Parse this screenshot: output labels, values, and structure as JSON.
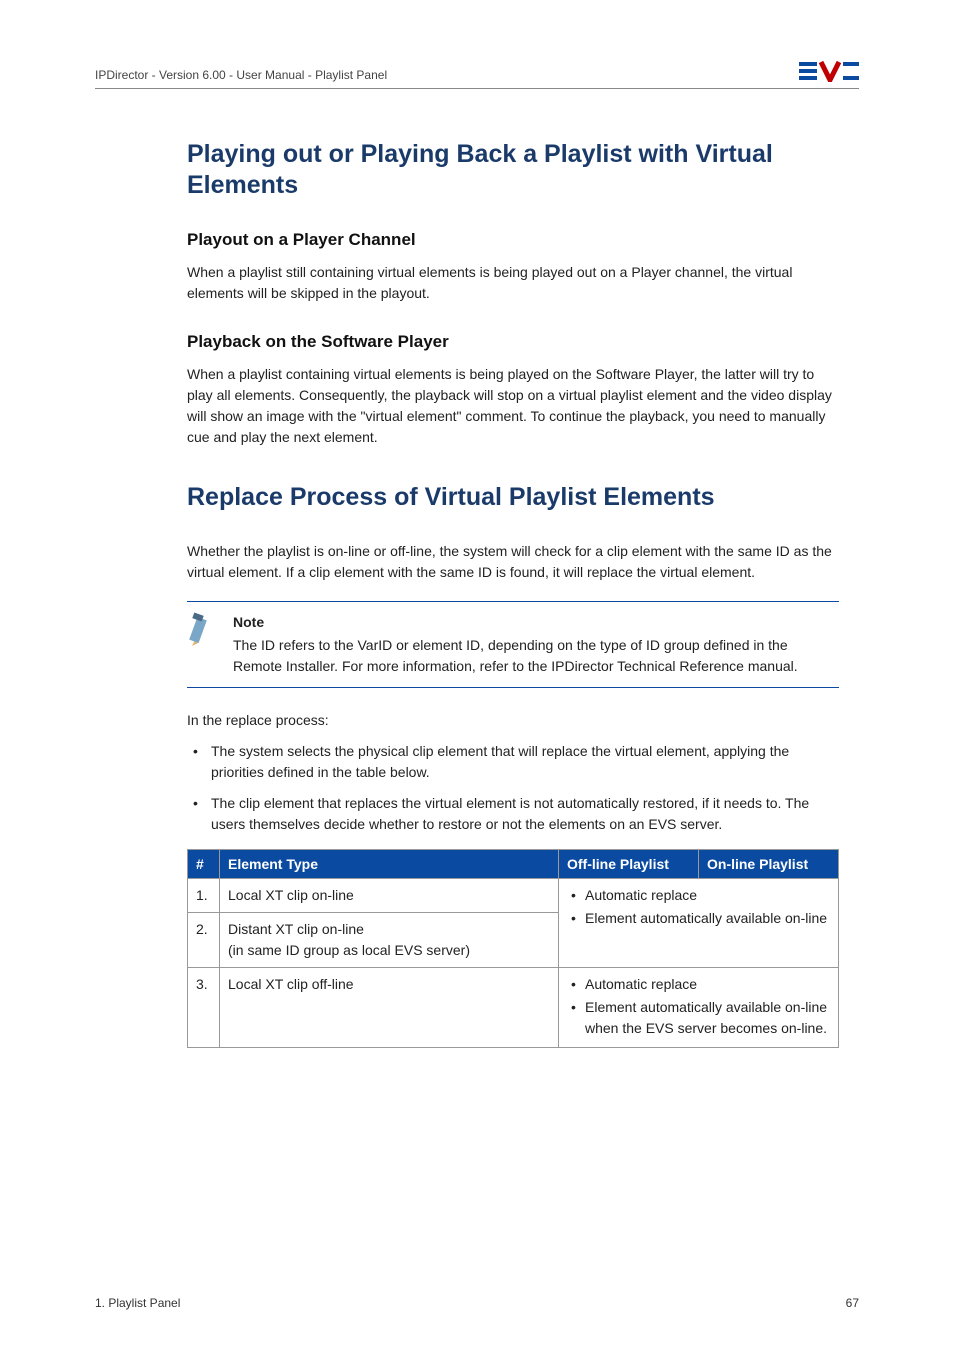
{
  "header": {
    "left": "IPDirector - Version 6.00 - User Manual - Playlist Panel",
    "logo_alt": "EVS"
  },
  "section1": {
    "title": "Playing out or Playing Back a Playlist with Virtual Elements",
    "sub1": {
      "heading": "Playout on a Player Channel",
      "para": "When a playlist still containing virtual elements is being played out on a Player channel, the virtual elements will be skipped in the playout."
    },
    "sub2": {
      "heading": "Playback on the Software Player",
      "para": "When a playlist containing virtual elements is being played on the Software Player, the latter will try to play all elements. Consequently, the playback will stop on a virtual playlist element and the video display will show an image with the \"virtual element\" comment. To continue the playback, you need to manually cue and play the next element."
    }
  },
  "section2": {
    "title": "Replace Process of Virtual Playlist Elements",
    "intro": "Whether the playlist is on-line or off-line, the system will check for a clip element with the same ID as the virtual element. If a clip element with the same ID is found, it will replace the virtual element.",
    "note": {
      "label": "Note",
      "body": "The ID refers to the VarID or element ID, depending on the type of ID group defined in the Remote Installer. For more information, refer to the IPDirector Technical Reference manual."
    },
    "replace_intro": "In the replace process:",
    "bullets": [
      "The system selects the physical clip element that will replace the virtual element, applying the priorities defined in the table below.",
      "The clip element that replaces the virtual element is not automatically restored, if it needs to. The users themselves decide whether to restore or not the elements on an EVS server."
    ],
    "table": {
      "headers": {
        "num": "#",
        "type": "Element Type",
        "offline": "Off-line Playlist",
        "online": "On-line Playlist"
      },
      "rows": [
        {
          "num": "1.",
          "type": "Local XT clip on-line"
        },
        {
          "num": "2.",
          "type_line1": "Distant XT clip on-line",
          "type_line2": "(in same ID group as local EVS server)"
        },
        {
          "num": "3.",
          "type": "Local XT clip off-line"
        }
      ],
      "cellA": {
        "li1": "Automatic replace",
        "li2": "Element automatically available on-line"
      },
      "cellB": {
        "li1": "Automatic replace",
        "li2": "Element automatically available on-line when the EVS server becomes on-line."
      }
    }
  },
  "footer": {
    "left": "1. Playlist Panel",
    "right": "67"
  }
}
